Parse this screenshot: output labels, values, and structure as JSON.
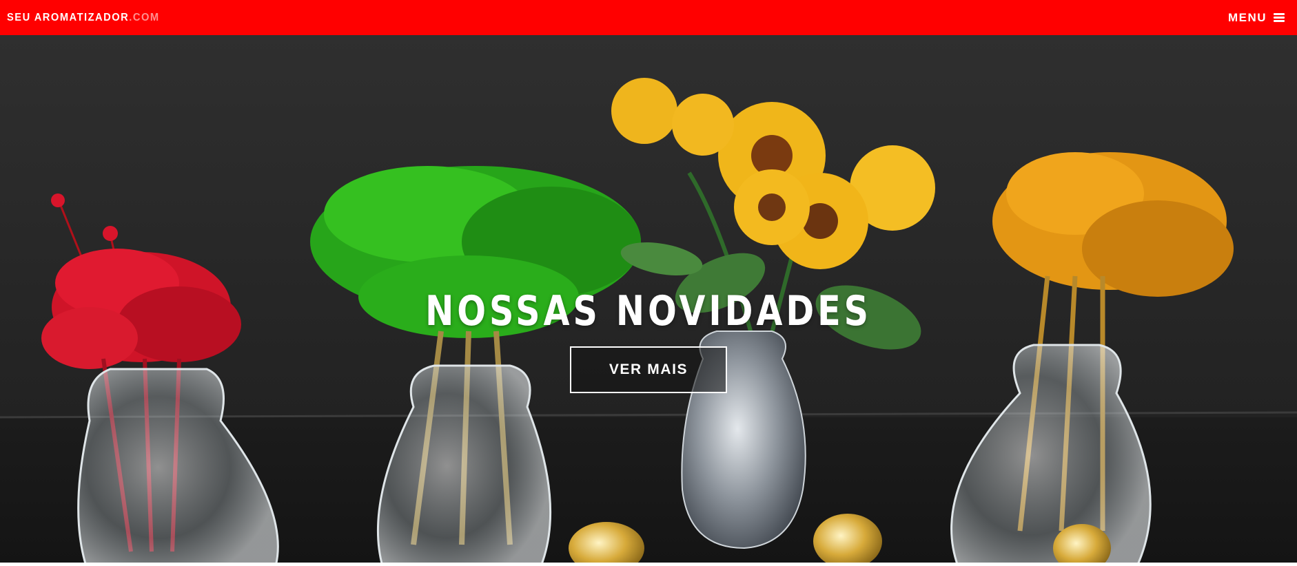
{
  "navbar": {
    "brand_main": "SEU AROMATIZADOR",
    "brand_suffix": ".COM",
    "menu_label": "MENU",
    "menu_icon": "hamburger-icon",
    "background_color": "#ff0000"
  },
  "hero": {
    "title": "NOSSAS NOVIDADES",
    "cta_label": "VER MAIS",
    "image_description_icons": [
      "red-flowers-vase",
      "green-flowers-vase",
      "sunflowers-silver-vase",
      "orange-flowers-vase"
    ]
  }
}
